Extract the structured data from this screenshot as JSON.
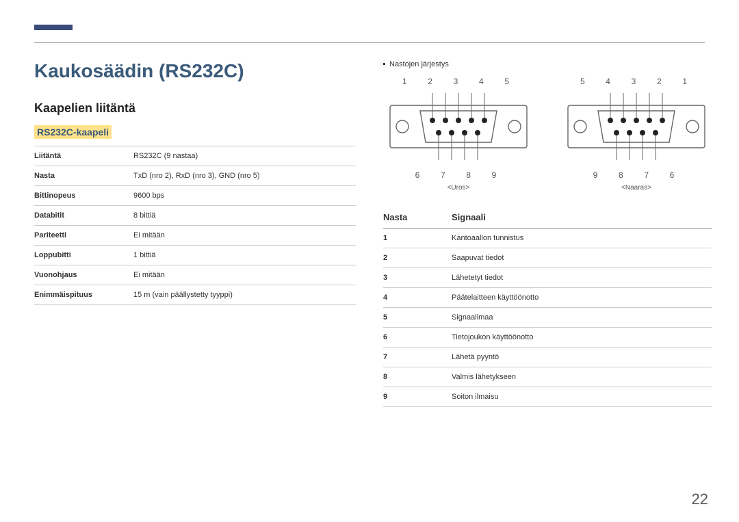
{
  "header": {
    "title": "Kaukosäädin (RS232C)",
    "subtitle": "Kaapelien liitäntä",
    "section": "RS232C-kaapeli"
  },
  "spec": {
    "rows": [
      {
        "k": "Liitäntä",
        "v": "RS232C (9 nastaa)"
      },
      {
        "k": "Nasta",
        "v": "TxD (nro 2), RxD (nro 3), GND (nro 5)"
      },
      {
        "k": "Bittinopeus",
        "v": "9600 bps"
      },
      {
        "k": "Databitit",
        "v": "8 bittiä"
      },
      {
        "k": "Pariteetti",
        "v": "Ei mitään"
      },
      {
        "k": "Loppubitti",
        "v": "1 bittiä"
      },
      {
        "k": "Vuonohjaus",
        "v": "Ei mitään"
      },
      {
        "k": "Enimmäispituus",
        "v": "15 m (vain päällystetty tyyppi)"
      }
    ]
  },
  "right": {
    "bullet_label": "Nastojen järjestys",
    "diag_male_top": "1  2  3  4  5",
    "diag_male_bottom": "6  7  8  9",
    "diag_male_label": "<Uros>",
    "diag_female_top": "5  4  3  2  1",
    "diag_female_bottom": "9  8  7  6",
    "diag_female_label": "<Naaras>",
    "signal_header_pin": "Nasta",
    "signal_header_sig": "Signaali",
    "signals": [
      {
        "n": "1",
        "s": "Kantoaallon tunnistus"
      },
      {
        "n": "2",
        "s": "Saapuvat tiedot"
      },
      {
        "n": "3",
        "s": "Lähetetyt tiedot"
      },
      {
        "n": "4",
        "s": "Päätelaitteen käyttöönotto"
      },
      {
        "n": "5",
        "s": "Signaalimaa"
      },
      {
        "n": "6",
        "s": "Tietojoukon käyttöönotto"
      },
      {
        "n": "7",
        "s": "Lähetä pyyntö"
      },
      {
        "n": "8",
        "s": "Valmis lähetykseen"
      },
      {
        "n": "9",
        "s": "Soiton ilmaisu"
      }
    ]
  },
  "page_number": "22"
}
